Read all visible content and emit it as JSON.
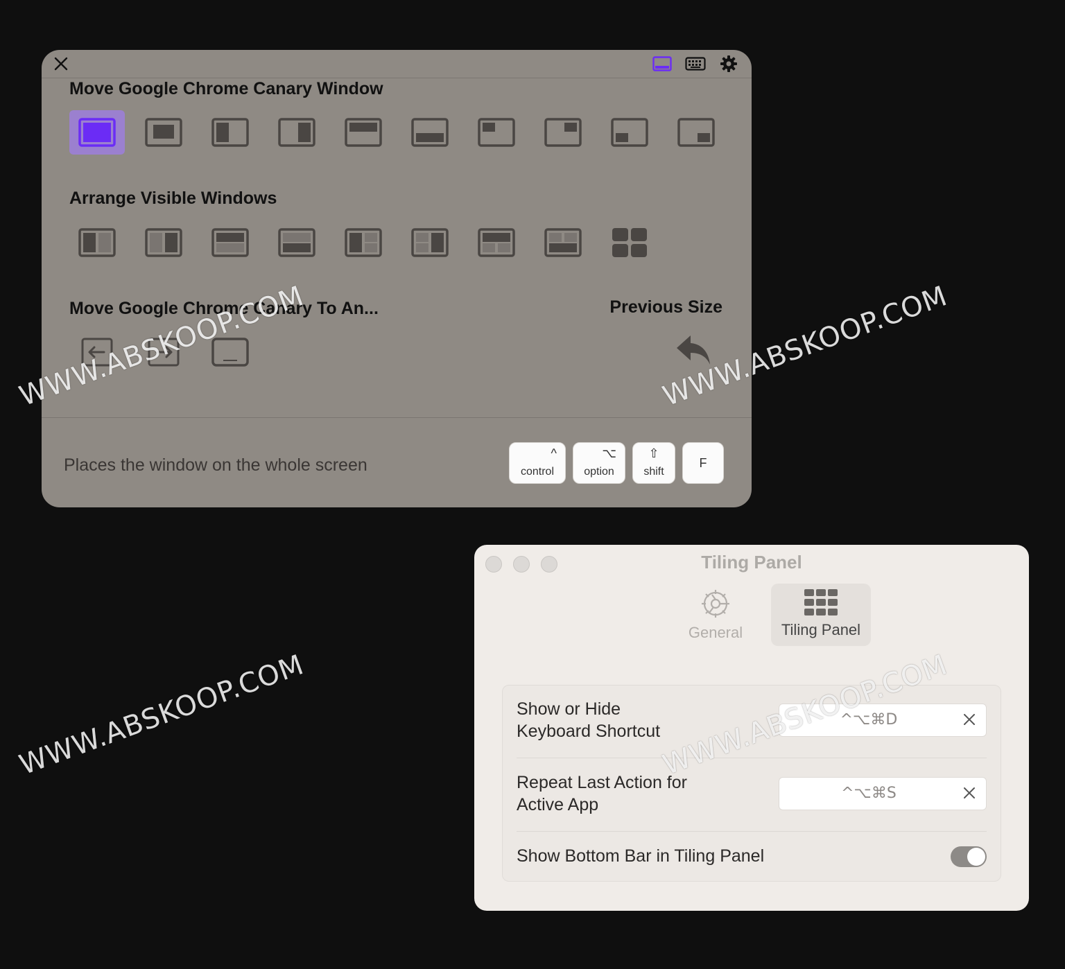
{
  "panel": {
    "section1_title": "Move Google Chrome Canary Window",
    "section2_title": "Arrange Visible Windows",
    "section3_title": "Move Google Chrome Canary To An...",
    "previous_size_title": "Previous Size",
    "description": "Places the window on the whole screen",
    "keys": [
      {
        "symbol": "^",
        "label": "control"
      },
      {
        "symbol": "⌥",
        "label": "option"
      },
      {
        "symbol": "⇧",
        "label": "shift"
      },
      {
        "symbol": "",
        "label": "F"
      }
    ],
    "accent_color": "#6b2cf5"
  },
  "window": {
    "title": "Tiling Panel",
    "tabs": [
      {
        "label": "General",
        "icon": "gear-icon"
      },
      {
        "label": "Tiling Panel",
        "icon": "grid-icon"
      }
    ],
    "rows": [
      {
        "label_line1": "Show or Hide",
        "label_line2": "Keyboard Shortcut",
        "shortcut": "^⌥⌘D"
      },
      {
        "label_line1": "Repeat Last Action for",
        "label_line2": "Active App",
        "shortcut": "^⌥⌘S"
      }
    ],
    "toggle_row": {
      "label": "Show Bottom Bar in Tiling Panel",
      "on": true
    }
  },
  "watermark": "WWW.ABSKOOP.COM"
}
